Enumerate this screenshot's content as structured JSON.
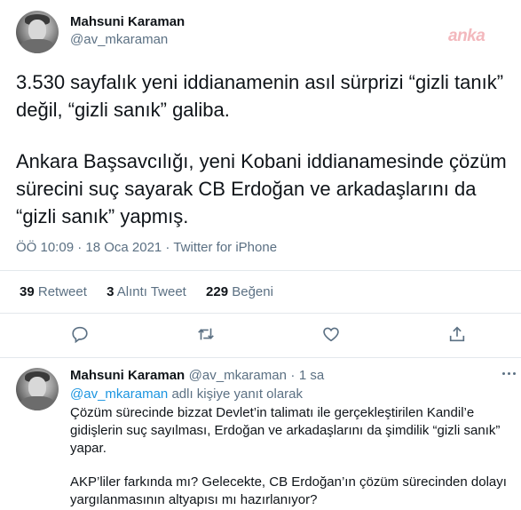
{
  "tweet": {
    "author_name": "Mahsuni Karaman",
    "author_handle": "@av_mkaraman",
    "paragraph1_line1": "3.530 sayfalık yeni iddianamenin asıl sürprizi “gizli tanık”",
    "paragraph1_line2": "değil, “gizli sanık” galiba.",
    "paragraph2_line1": "Ankara Başsavcılığı, yeni Kobani iddianamesinde çözüm",
    "paragraph2_line2": "sürecini suç sayarak CB Erdoğan ve arkadaşlarını da",
    "paragraph2_line3": "“gizli sanık” yapmış.",
    "meta": "ÖÖ 10:09 · 18 Oca 2021 · Twitter for iPhone",
    "retweets_count": "39",
    "retweets_label": "Retweet",
    "quotes_count": "3",
    "quotes_label": "Alıntı Tweet",
    "likes_count": "229",
    "likes_label": "Beğeni"
  },
  "watermark": "anka",
  "actions": {
    "icons": [
      "reply-icon",
      "retweet-icon",
      "like-icon",
      "share-icon"
    ]
  },
  "reply": {
    "author_name": "Mahsuni Karaman",
    "author_handle": "@av_mkaraman",
    "time_sep": "·",
    "time": "1 sa",
    "replying_to_handle": "@av_mkaraman",
    "replying_to_suffix": " adlı kişiye yanıt olarak",
    "line1": "Çözüm sürecinde bizzat Devlet’in talimatı ile gerçekleştirilen Kandil’e",
    "line2": "gidişlerin suç sayılması, Erdoğan ve arkadaşlarını da şimdilik “gizli sanık”",
    "line3": "yapar.",
    "line4": "AKP’liler farkında mı? Gelecekte, CB Erdoğan’ın çözüm sürecinden dolayı",
    "line5": "yargılanmasının altyapısı mı hazırlanıyor?"
  },
  "colors": {
    "text": "#0f1419",
    "secondary": "#5b7083",
    "link": "#1b95e0",
    "divider": "#e3e8ec",
    "watermark": "#f3b8bd"
  }
}
